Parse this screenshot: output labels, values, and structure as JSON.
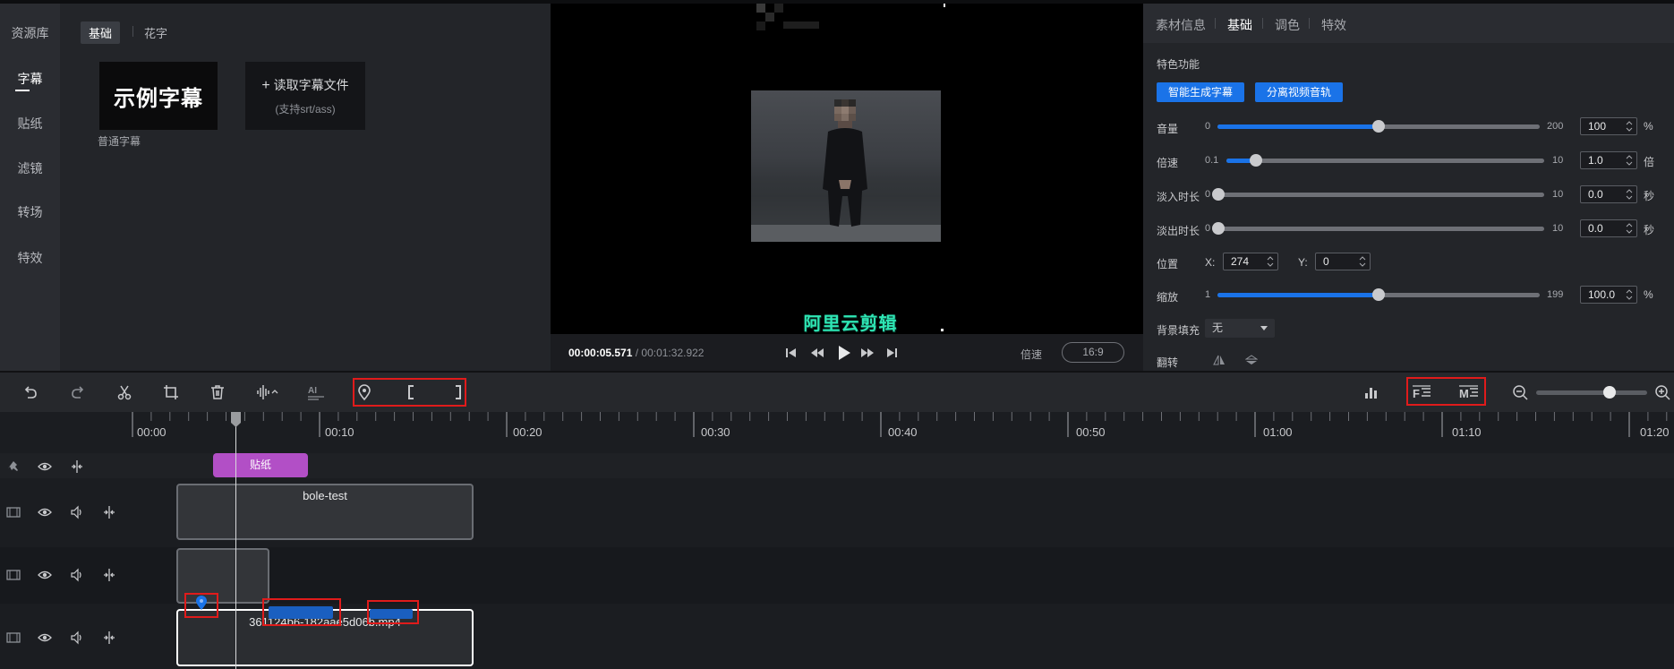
{
  "sidebar": {
    "title": "资源库",
    "items": [
      {
        "label": "字幕",
        "active": true
      },
      {
        "label": "贴纸"
      },
      {
        "label": "滤镜"
      },
      {
        "label": "转场"
      },
      {
        "label": "特效"
      }
    ]
  },
  "resources": {
    "tabs": [
      {
        "label": "基础",
        "active": true
      },
      {
        "label": "花字"
      }
    ],
    "cards": {
      "sample_text": "示例字幕",
      "sample_caption": "普通字幕",
      "import_label": "读取字幕文件",
      "import_hint": "(支持srt/ass)"
    }
  },
  "player": {
    "subtitle_overlay": "阿里云剪辑",
    "current_time": "00:00:05.571",
    "time_separator": " / ",
    "total_time": "00:01:32.922",
    "speed_label": "倍速",
    "aspect_ratio": "16:9"
  },
  "properties": {
    "tabs": [
      {
        "label": "素材信息"
      },
      {
        "label": "基础",
        "active": true
      },
      {
        "label": "调色"
      },
      {
        "label": "特效"
      }
    ],
    "section_title": "特色功能",
    "buttons": {
      "gen_subtitle": "智能生成字幕",
      "split_audio": "分离视频音轨"
    },
    "volume": {
      "label": "音量",
      "min": "0",
      "max": "200",
      "value": "100",
      "unit": "%",
      "level": 0.5
    },
    "speed": {
      "label": "倍速",
      "min": "0.1",
      "max": "10",
      "value": "1.0",
      "unit": "倍",
      "level": 0.09
    },
    "fade_in": {
      "label": "淡入时长",
      "min": "0",
      "max": "10",
      "value": "0.0",
      "unit": "秒",
      "level": 0
    },
    "fade_out": {
      "label": "淡出时长",
      "min": "0",
      "max": "10",
      "value": "0.0",
      "unit": "秒",
      "level": 0
    },
    "position": {
      "label": "位置",
      "x_label": "X:",
      "x_value": "274",
      "y_label": "Y:",
      "y_value": "0"
    },
    "scale": {
      "label": "缩放",
      "min": "1",
      "max": "199",
      "value": "100.0",
      "unit": "%",
      "level": 0.5
    },
    "bg_fill": {
      "label": "背景填充",
      "value": "无"
    },
    "flip": {
      "label": "翻转"
    }
  },
  "timeline": {
    "ruler_labels": [
      "00:00",
      "00:10",
      "00:20",
      "00:30",
      "00:40",
      "00:50",
      "01:00",
      "01:10",
      "01:20"
    ],
    "sticker_label": "贴纸",
    "video_clip_title": "bole-test",
    "main_clip_title": "361124b6-182aae5d06b.mp4",
    "zoom_level": 0.75
  },
  "colors": {
    "accent": "#1a73e8",
    "sticker": "#b24fc6",
    "highlight": "#e01b1b"
  }
}
